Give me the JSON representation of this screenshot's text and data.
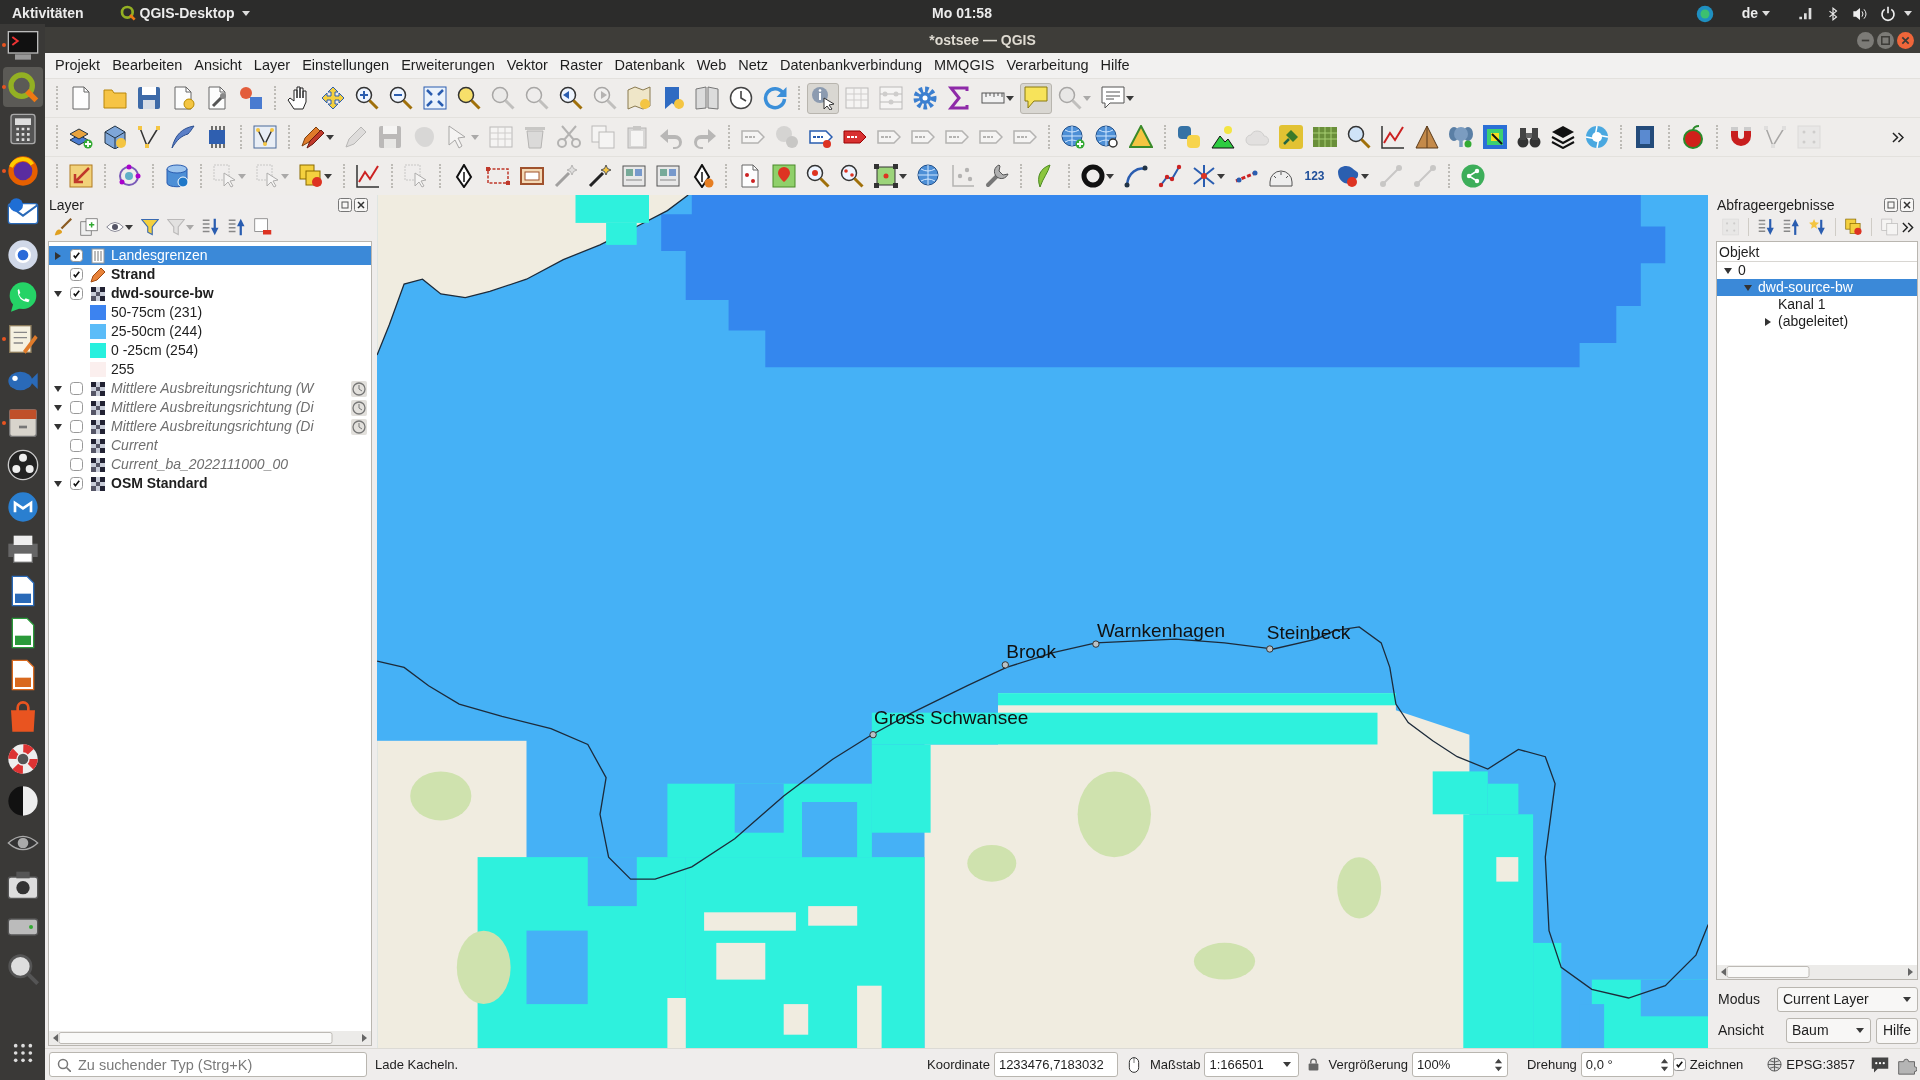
{
  "top_bar": {
    "activities": "Aktivitäten",
    "app_menu": "QGIS-Desktop",
    "clock": "Mo 01:58",
    "language": "de"
  },
  "dock": [
    {
      "kind": "terminal",
      "running": true,
      "selected": false
    },
    {
      "kind": "ring",
      "running": true,
      "selected": true
    },
    {
      "kind": "calculator",
      "running": false,
      "selected": false
    },
    {
      "kind": "globe",
      "running": true,
      "selected": false
    },
    {
      "kind": "envelope",
      "running": false,
      "selected": false
    },
    {
      "kind": "disc",
      "running": false,
      "selected": false
    },
    {
      "kind": "chat",
      "running": false,
      "selected": false
    },
    {
      "kind": "notepad",
      "running": true,
      "selected": false
    },
    {
      "kind": "fish",
      "running": false,
      "selected": false
    },
    {
      "kind": "drawer",
      "running": true,
      "selected": false
    },
    {
      "kind": "dots-disc",
      "running": false,
      "selected": false
    },
    {
      "kind": "wave-disc",
      "running": false,
      "selected": false
    },
    {
      "kind": "printer",
      "running": false,
      "selected": false
    },
    {
      "kind": "document",
      "running": false,
      "selected": false
    },
    {
      "kind": "spreadsheet",
      "running": false,
      "selected": false
    },
    {
      "kind": "presentation",
      "running": false,
      "selected": false
    },
    {
      "kind": "bag",
      "running": false,
      "selected": false
    },
    {
      "kind": "lifebuoy",
      "running": false,
      "selected": false
    },
    {
      "kind": "half-disc",
      "running": false,
      "selected": false
    },
    {
      "kind": "eye",
      "running": false,
      "selected": false
    },
    {
      "kind": "camera",
      "running": false,
      "selected": false
    },
    {
      "kind": "drive",
      "running": false,
      "selected": false
    },
    {
      "kind": "magnifier",
      "running": false,
      "selected": false
    }
  ],
  "window": {
    "title": "*ostsee — QGIS"
  },
  "menu": [
    "Projekt",
    "Bearbeiten",
    "Ansicht",
    "Layer",
    "Einstellungen",
    "Erweiterungen",
    "Vektor",
    "Raster",
    "Datenbank",
    "Web",
    "Netz",
    "Datenbankverbindung",
    "MMQGIS",
    "Verarbeitung",
    "Hilfe"
  ],
  "toolbar_rows": [
    {
      "overflow": false,
      "groups": [
        [
          {
            "kind": "new-project",
            "disabled": false,
            "pressed": false,
            "dropdown": false
          },
          {
            "kind": "open-project",
            "disabled": false,
            "pressed": false,
            "dropdown": false
          },
          {
            "kind": "save-project",
            "disabled": false,
            "pressed": false,
            "dropdown": false
          },
          {
            "kind": "new-layout",
            "disabled": false,
            "pressed": false,
            "dropdown": false
          },
          {
            "kind": "layout-manager",
            "disabled": false,
            "pressed": false,
            "dropdown": false
          },
          {
            "kind": "style-manager",
            "disabled": false,
            "pressed": false,
            "dropdown": false
          }
        ],
        [
          {
            "kind": "pan",
            "disabled": false,
            "pressed": false,
            "dropdown": false
          },
          {
            "kind": "pan-selection",
            "disabled": false,
            "pressed": false,
            "dropdown": false
          },
          {
            "kind": "zoom-in",
            "disabled": false,
            "pressed": false,
            "dropdown": false
          },
          {
            "kind": "zoom-out",
            "disabled": false,
            "pressed": false,
            "dropdown": false
          },
          {
            "kind": "zoom-full",
            "disabled": false,
            "pressed": false,
            "dropdown": false
          },
          {
            "kind": "zoom-selection",
            "disabled": false,
            "pressed": false,
            "dropdown": false
          },
          {
            "kind": "zoom-layer",
            "disabled": true,
            "pressed": false,
            "dropdown": false
          },
          {
            "kind": "zoom-native",
            "disabled": true,
            "pressed": false,
            "dropdown": false
          },
          {
            "kind": "zoom-last",
            "disabled": false,
            "pressed": false,
            "dropdown": false
          },
          {
            "kind": "zoom-next",
            "disabled": true,
            "pressed": false,
            "dropdown": false
          },
          {
            "kind": "new-bookmark",
            "disabled": false,
            "pressed": false,
            "dropdown": false
          },
          {
            "kind": "show-bookmarks",
            "disabled": false,
            "pressed": false,
            "dropdown": false
          },
          {
            "kind": "bookmark-book",
            "disabled": false,
            "pressed": false,
            "dropdown": false
          },
          {
            "kind": "temporal",
            "disabled": false,
            "pressed": false,
            "dropdown": false
          },
          {
            "kind": "refresh",
            "disabled": false,
            "pressed": false,
            "dropdown": false
          }
        ],
        [
          {
            "kind": "identify",
            "disabled": false,
            "pressed": true,
            "dropdown": false
          },
          {
            "kind": "attribute-table",
            "disabled": true,
            "pressed": false,
            "dropdown": false
          },
          {
            "kind": "field-calculator",
            "disabled": true,
            "pressed": false,
            "dropdown": false
          },
          {
            "kind": "toolbox",
            "disabled": false,
            "pressed": false,
            "dropdown": false
          },
          {
            "kind": "statistics",
            "disabled": false,
            "pressed": false,
            "dropdown": false
          },
          {
            "kind": "measure",
            "disabled": false,
            "pressed": false,
            "dropdown": true
          },
          {
            "kind": "map-tips",
            "disabled": false,
            "pressed": true,
            "dropdown": false
          },
          {
            "kind": "annotation",
            "disabled": true,
            "pressed": false,
            "dropdown": true
          },
          {
            "kind": "text-annotation",
            "disabled": false,
            "pressed": false,
            "dropdown": true
          }
        ]
      ]
    },
    {
      "overflow": true,
      "groups": [
        [
          {
            "kind": "data-source",
            "disabled": false,
            "pressed": false,
            "dropdown": false
          },
          {
            "kind": "new-geopackage",
            "disabled": false,
            "pressed": false,
            "dropdown": false
          },
          {
            "kind": "new-shapefile",
            "disabled": false,
            "pressed": false,
            "dropdown": false
          },
          {
            "kind": "new-spatialite",
            "disabled": false,
            "pressed": false,
            "dropdown": false
          },
          {
            "kind": "new-virtual",
            "disabled": false,
            "pressed": false,
            "dropdown": false
          }
        ],
        [
          {
            "kind": "vertex-box",
            "disabled": false,
            "pressed": false,
            "dropdown": false
          }
        ],
        [
          {
            "kind": "toggle-editing",
            "disabled": false,
            "pressed": false,
            "dropdown": true
          },
          {
            "kind": "edit-pencil",
            "disabled": true,
            "pressed": false,
            "dropdown": false
          },
          {
            "kind": "save-edits",
            "disabled": true,
            "pressed": false,
            "dropdown": false
          },
          {
            "kind": "add-feature",
            "disabled": true,
            "pressed": false,
            "dropdown": false
          },
          {
            "kind": "vertex-tool",
            "disabled": true,
            "pressed": false,
            "dropdown": true
          },
          {
            "kind": "table-edit",
            "disabled": true,
            "pressed": false,
            "dropdown": false
          },
          {
            "kind": "delete",
            "disabled": true,
            "pressed": false,
            "dropdown": false
          },
          {
            "kind": "cut",
            "disabled": true,
            "pressed": false,
            "dropdown": false
          },
          {
            "kind": "copy",
            "disabled": true,
            "pressed": false,
            "dropdown": false
          },
          {
            "kind": "paste",
            "disabled": true,
            "pressed": false,
            "dropdown": false
          },
          {
            "kind": "undo",
            "disabled": true,
            "pressed": false,
            "dropdown": false
          },
          {
            "kind": "redo",
            "disabled": true,
            "pressed": false,
            "dropdown": false
          }
        ],
        [
          {
            "kind": "label-tag",
            "disabled": true,
            "pressed": false,
            "dropdown": false
          },
          {
            "kind": "label-circles",
            "disabled": true,
            "pressed": false,
            "dropdown": false
          },
          {
            "kind": "label-pin",
            "disabled": false,
            "pressed": false,
            "dropdown": false
          },
          {
            "kind": "label-red",
            "disabled": false,
            "pressed": false,
            "dropdown": false
          },
          {
            "kind": "label-tag",
            "disabled": true,
            "pressed": false,
            "dropdown": false
          },
          {
            "kind": "label-tag",
            "disabled": true,
            "pressed": false,
            "dropdown": false
          },
          {
            "kind": "label-tag",
            "disabled": true,
            "pressed": false,
            "dropdown": false
          },
          {
            "kind": "label-tag",
            "disabled": true,
            "pressed": false,
            "dropdown": false
          },
          {
            "kind": "label-tag",
            "disabled": true,
            "pressed": false,
            "dropdown": false
          }
        ],
        [
          {
            "kind": "globe-plus",
            "disabled": false,
            "pressed": false,
            "dropdown": false
          },
          {
            "kind": "globe-search",
            "disabled": false,
            "pressed": false,
            "dropdown": false
          },
          {
            "kind": "triangle",
            "disabled": false,
            "pressed": false,
            "dropdown": false
          }
        ],
        [
          {
            "kind": "python",
            "disabled": false,
            "pressed": false,
            "dropdown": false
          },
          {
            "kind": "hill",
            "disabled": false,
            "pressed": false,
            "dropdown": false
          },
          {
            "kind": "cloud",
            "disabled": true,
            "pressed": false,
            "dropdown": false
          },
          {
            "kind": "plug",
            "disabled": false,
            "pressed": false,
            "dropdown": false
          },
          {
            "kind": "raster-grid",
            "disabled": false,
            "pressed": false,
            "dropdown": false
          },
          {
            "kind": "magnifier-q",
            "disabled": false,
            "pressed": false,
            "dropdown": false
          },
          {
            "kind": "line-chart",
            "disabled": false,
            "pressed": false,
            "dropdown": false
          },
          {
            "kind": "pyramid",
            "disabled": false,
            "pressed": false,
            "dropdown": false
          },
          {
            "kind": "elephant",
            "disabled": false,
            "pressed": false,
            "dropdown": false
          },
          {
            "kind": "heatmap",
            "disabled": false,
            "pressed": false,
            "dropdown": false
          },
          {
            "kind": "binoculars",
            "disabled": false,
            "pressed": false,
            "dropdown": false
          },
          {
            "kind": "layers-stack",
            "disabled": false,
            "pressed": false,
            "dropdown": false
          },
          {
            "kind": "aperture",
            "disabled": false,
            "pressed": false,
            "dropdown": false
          }
        ],
        [
          {
            "kind": "help-book",
            "disabled": false,
            "pressed": false,
            "dropdown": false
          }
        ],
        [
          {
            "kind": "apple",
            "disabled": false,
            "pressed": false,
            "dropdown": false
          }
        ],
        [
          {
            "kind": "magnet",
            "disabled": false,
            "pressed": false,
            "dropdown": false
          },
          {
            "kind": "snap-vertex",
            "disabled": true,
            "pressed": false,
            "dropdown": false
          },
          {
            "kind": "dotted-square",
            "disabled": true,
            "pressed": false,
            "dropdown": false
          }
        ]
      ]
    },
    {
      "overflow": false,
      "groups": [
        [
          {
            "kind": "svg-arrow",
            "disabled": false,
            "pressed": false,
            "dropdown": false
          }
        ],
        [
          {
            "kind": "node-ring",
            "disabled": false,
            "pressed": false,
            "dropdown": false
          }
        ],
        [
          {
            "kind": "database",
            "disabled": false,
            "pressed": false,
            "dropdown": false
          }
        ],
        [
          {
            "kind": "select-box",
            "disabled": true,
            "pressed": false,
            "dropdown": true
          },
          {
            "kind": "select-box",
            "disabled": true,
            "pressed": false,
            "dropdown": true
          },
          {
            "kind": "squares",
            "disabled": false,
            "pressed": false,
            "dropdown": true
          }
        ],
        [
          {
            "kind": "line-chart",
            "disabled": false,
            "pressed": false,
            "dropdown": false
          }
        ],
        [
          {
            "kind": "cursor-box",
            "disabled": true,
            "pressed": false,
            "dropdown": false
          }
        ],
        [
          {
            "kind": "pen-nib",
            "disabled": false,
            "pressed": false,
            "dropdown": false
          },
          {
            "kind": "rect-dashed",
            "disabled": false,
            "pressed": false,
            "dropdown": false
          },
          {
            "kind": "rect-frame",
            "disabled": false,
            "pressed": false,
            "dropdown": false
          },
          {
            "kind": "magic-wand",
            "disabled": true,
            "pressed": false,
            "dropdown": false
          },
          {
            "kind": "magic-wand",
            "disabled": false,
            "pressed": false,
            "dropdown": false
          },
          {
            "kind": "map-pages",
            "disabled": false,
            "pressed": false,
            "dropdown": false
          },
          {
            "kind": "map-pages",
            "disabled": false,
            "pressed": false,
            "dropdown": false
          },
          {
            "kind": "nib-question",
            "disabled": false,
            "pressed": false,
            "dropdown": false
          }
        ],
        [
          {
            "kind": "doc-pins",
            "disabled": false,
            "pressed": false,
            "dropdown": false
          },
          {
            "kind": "map-pin",
            "disabled": false,
            "pressed": false,
            "dropdown": false
          },
          {
            "kind": "magnifier-red",
            "disabled": false,
            "pressed": false,
            "dropdown": false
          },
          {
            "kind": "magnifier-dots",
            "disabled": false,
            "pressed": false,
            "dropdown": false
          },
          {
            "kind": "square-nodes",
            "disabled": false,
            "pressed": false,
            "dropdown": true
          },
          {
            "kind": "globe",
            "disabled": false,
            "pressed": false,
            "dropdown": false
          },
          {
            "kind": "grid-points",
            "disabled": true,
            "pressed": false,
            "dropdown": false
          },
          {
            "kind": "wrench",
            "disabled": false,
            "pressed": false,
            "dropdown": false
          }
        ],
        [
          {
            "kind": "leaf",
            "disabled": false,
            "pressed": false,
            "dropdown": false
          }
        ],
        [
          {
            "kind": "ring",
            "disabled": false,
            "pressed": false,
            "dropdown": true
          },
          {
            "kind": "curve",
            "disabled": false,
            "pressed": false,
            "dropdown": false
          },
          {
            "kind": "polyline",
            "disabled": false,
            "pressed": false,
            "dropdown": false
          },
          {
            "kind": "asterisk",
            "disabled": false,
            "pressed": false,
            "dropdown": true
          },
          {
            "kind": "dashed-line",
            "disabled": false,
            "pressed": false,
            "dropdown": false
          },
          {
            "kind": "arch-ruler",
            "disabled": false,
            "pressed": false,
            "dropdown": false
          },
          {
            "kind": "numbers",
            "label": "123",
            "disabled": false,
            "pressed": false,
            "dropdown": false
          },
          {
            "kind": "blob",
            "disabled": false,
            "pressed": false,
            "dropdown": true
          },
          {
            "kind": "nodes",
            "disabled": true,
            "pressed": false,
            "dropdown": false
          },
          {
            "kind": "nodes",
            "disabled": true,
            "pressed": false,
            "dropdown": false
          }
        ],
        [
          {
            "kind": "share",
            "disabled": false,
            "pressed": false,
            "dropdown": false
          }
        ]
      ]
    }
  ],
  "layers_panel": {
    "title": "Layer",
    "toolbar": [
      {
        "kind": "paintbrush",
        "disabled": false,
        "dropdown": false
      },
      {
        "kind": "add-group",
        "disabled": false,
        "dropdown": false
      },
      {
        "kind": "eye",
        "disabled": false,
        "dropdown": true
      },
      {
        "kind": "funnel",
        "disabled": false,
        "dropdown": false
      },
      {
        "kind": "filter-expression",
        "disabled": true,
        "dropdown": true
      },
      {
        "kind": "expand-all",
        "disabled": false,
        "dropdown": false
      },
      {
        "kind": "collapse-all",
        "disabled": false,
        "dropdown": false
      },
      {
        "kind": "remove-layer",
        "disabled": false,
        "dropdown": false
      }
    ],
    "layers": [
      {
        "name": "Landesgrenzen",
        "kind": "vector",
        "expandable": true,
        "expanded": false,
        "checked": true,
        "selected": true,
        "bold": false,
        "temporal": false
      },
      {
        "name": "Strand",
        "kind": "point",
        "expandable": false,
        "checked": true,
        "selected": false,
        "bold": true,
        "temporal": false
      },
      {
        "name": "dwd-source-bw",
        "kind": "raster",
        "expandable": true,
        "expanded": true,
        "checked": true,
        "selected": false,
        "bold": true,
        "temporal": false,
        "children": [
          {
            "label": "50-75cm (231)",
            "color": "#3c83f0"
          },
          {
            "label": "25-50cm (244)",
            "color": "#5bbcf8"
          },
          {
            "label": "0 -25cm (254)",
            "color": "#27f0de"
          },
          {
            "label": "255",
            "color": "#fbefee"
          }
        ]
      },
      {
        "name": "Mittlere Ausbreitungsrichtung (W",
        "kind": "raster",
        "expandable": true,
        "expanded": true,
        "checked": false,
        "selected": false,
        "bold": false,
        "temporal": true
      },
      {
        "name": "Mittlere Ausbreitungsrichtung (Di",
        "kind": "raster",
        "expandable": true,
        "expanded": true,
        "checked": false,
        "selected": false,
        "bold": false,
        "temporal": true
      },
      {
        "name": "Mittlere Ausbreitungsrichtung (Di",
        "kind": "raster",
        "expandable": true,
        "expanded": true,
        "checked": false,
        "selected": false,
        "bold": false,
        "temporal": true
      },
      {
        "name": "Current",
        "kind": "raster",
        "expandable": false,
        "checked": false,
        "selected": false,
        "bold": false,
        "temporal": false
      },
      {
        "name": "Current_ba_2022111000_00",
        "kind": "raster",
        "expandable": false,
        "checked": false,
        "selected": false,
        "bold": false,
        "temporal": false
      },
      {
        "name": "OSM Standard",
        "kind": "raster",
        "expandable": true,
        "expanded": true,
        "checked": true,
        "selected": false,
        "bold": true,
        "temporal": false
      }
    ]
  },
  "map": {
    "places": [
      {
        "name": "Warnkenhagen"
      },
      {
        "name": "Steinbeck"
      },
      {
        "name": "Brook"
      },
      {
        "name": "Gross Schwansee"
      }
    ]
  },
  "results_panel": {
    "title": "Abfrageergebnisse",
    "toolbar": {
      "overflow": true,
      "groups": [
        [
          {
            "kind": "dotted-square",
            "disabled": true,
            "dropdown": false
          }
        ],
        [
          {
            "kind": "expand-all",
            "disabled": false,
            "dropdown": false
          },
          {
            "kind": "collapse-all",
            "disabled": false,
            "dropdown": false
          },
          {
            "kind": "star-expand",
            "disabled": false,
            "dropdown": false
          }
        ],
        [
          {
            "kind": "squares",
            "disabled": false,
            "dropdown": false
          }
        ],
        [
          {
            "kind": "copy",
            "disabled": true,
            "dropdown": false
          }
        ]
      ]
    },
    "column": "Objekt",
    "tree": [
      {
        "label": "0",
        "expandable": true,
        "expanded": true,
        "selected": false,
        "children": [
          {
            "label": "dwd-source-bw",
            "expandable": true,
            "expanded": true,
            "selected": true,
            "children": [
              {
                "label": "Kanal 1",
                "expandable": false,
                "selected": false
              },
              {
                "label": "(abgeleitet)",
                "expandable": true,
                "expanded": false,
                "selected": false
              }
            ]
          }
        ]
      }
    ],
    "mode_label": "Modus",
    "mode": "Current Layer",
    "view_label": "Ansicht",
    "view": "Baum",
    "help": "Hilfe"
  },
  "status_bar": {
    "search_placeholder": "Zu suchender Typ (Strg+K)",
    "message": "Lade Kacheln.",
    "coordinate_label": "Koordinate",
    "coordinate": "1233476,7183032",
    "scale_label": "Maßstab",
    "scale": "1:166501",
    "magnifier_label": "Vergrößerung",
    "magnifier": "100%",
    "rotation_label": "Drehung",
    "rotation": "0,0 °",
    "render_label": "Zeichnen",
    "render": true,
    "crs": "EPSG:3857"
  }
}
